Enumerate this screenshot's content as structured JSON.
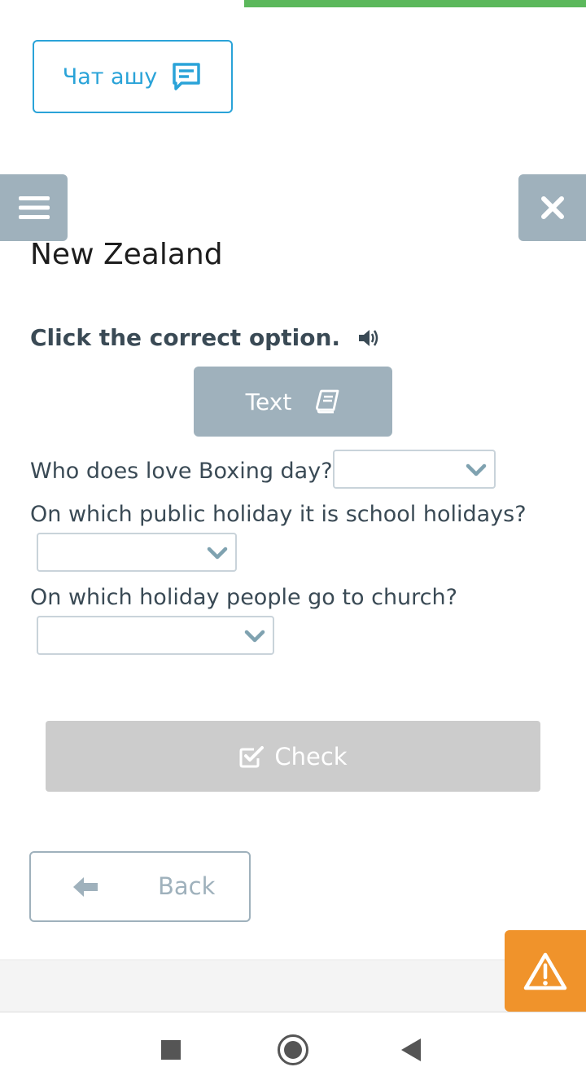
{
  "header": {
    "chat_label": "Чат ашу"
  },
  "lesson": {
    "title": "New Zealand",
    "instruction": "Click the correct option.",
    "text_button_label": "Text"
  },
  "questions": [
    {
      "text": "Who does love Boxing day?",
      "selected": ""
    },
    {
      "text": "On which public holiday it is school holidays?",
      "selected": ""
    },
    {
      "text": "On which holiday people go to church?",
      "selected": ""
    }
  ],
  "actions": {
    "check_label": "Check",
    "back_label": "Back"
  },
  "colors": {
    "accent_blue": "#2aa3d8",
    "panel_grey": "#9fb1bc",
    "progress_green": "#5cb85c",
    "warning_orange": "#f0932b",
    "disabled_grey": "#cccccc"
  },
  "icons": {
    "chat": "chat-bubble-icon",
    "menu": "hamburger-menu-icon",
    "close": "close-icon",
    "audio": "speaker-icon",
    "text": "book-icon",
    "dropdown": "chevron-down-icon",
    "check": "checkbox-checked-icon",
    "back": "arrow-left-icon",
    "warning": "warning-triangle-icon"
  }
}
